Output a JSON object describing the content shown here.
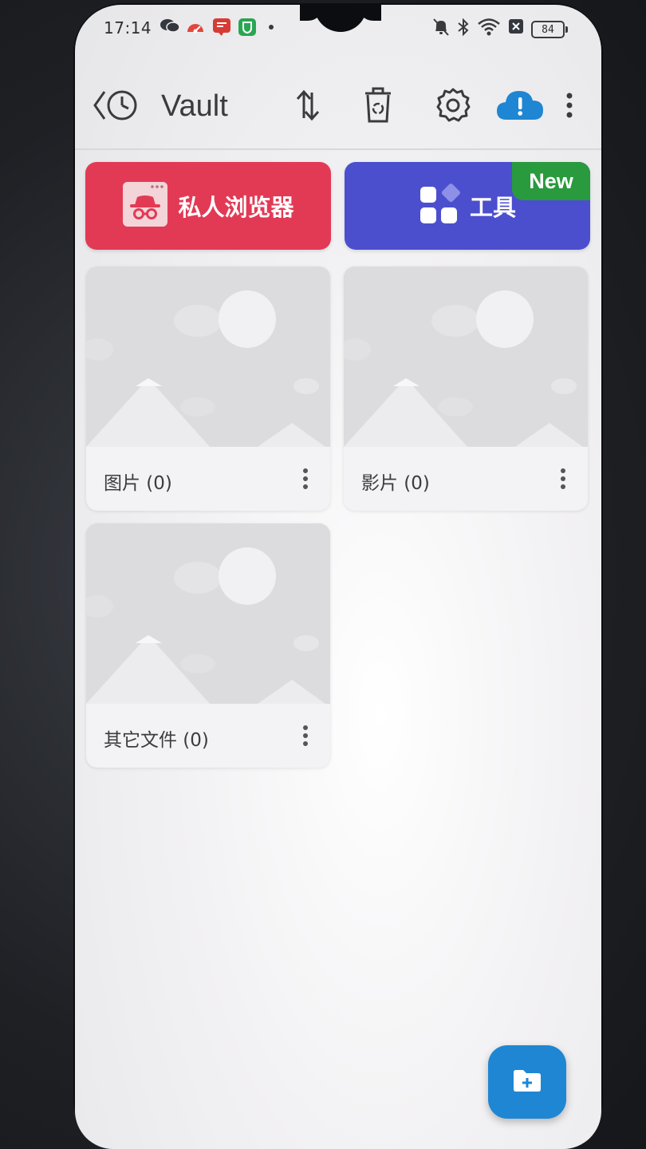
{
  "status_bar": {
    "time": "17:14",
    "battery": "84",
    "left_icons": [
      "wechat-icon",
      "speedometer-icon",
      "message-app-icon",
      "shield-app-icon",
      "dot-icon"
    ],
    "right_icons": [
      "mute-bell-icon",
      "bluetooth-icon",
      "wifi-icon",
      "sim-off-icon",
      "battery-icon"
    ]
  },
  "toolbar": {
    "back_icon": "back-history-icon",
    "title": "Vault",
    "actions": [
      "sort-icon",
      "recycle-bin-icon",
      "gear-icon",
      "cloud-alert-icon",
      "more-vertical-icon"
    ]
  },
  "feature_cards": {
    "browser": {
      "label": "私人浏览器",
      "icon": "incognito-browser-icon",
      "color": "#e23a55"
    },
    "tools": {
      "label": "工具",
      "icon": "apps-grid-icon",
      "badge": "New",
      "color": "#4b4fce",
      "badge_color": "#2a9a3e"
    }
  },
  "folders": [
    {
      "label": "图片 (0)",
      "icon": "image-placeholder-icon"
    },
    {
      "label": "影片 (0)",
      "icon": "image-placeholder-icon"
    },
    {
      "label": "其它文件 (0)",
      "icon": "image-placeholder-icon"
    }
  ],
  "fab": {
    "icon": "add-folder-icon",
    "color": "#1f86d3"
  }
}
